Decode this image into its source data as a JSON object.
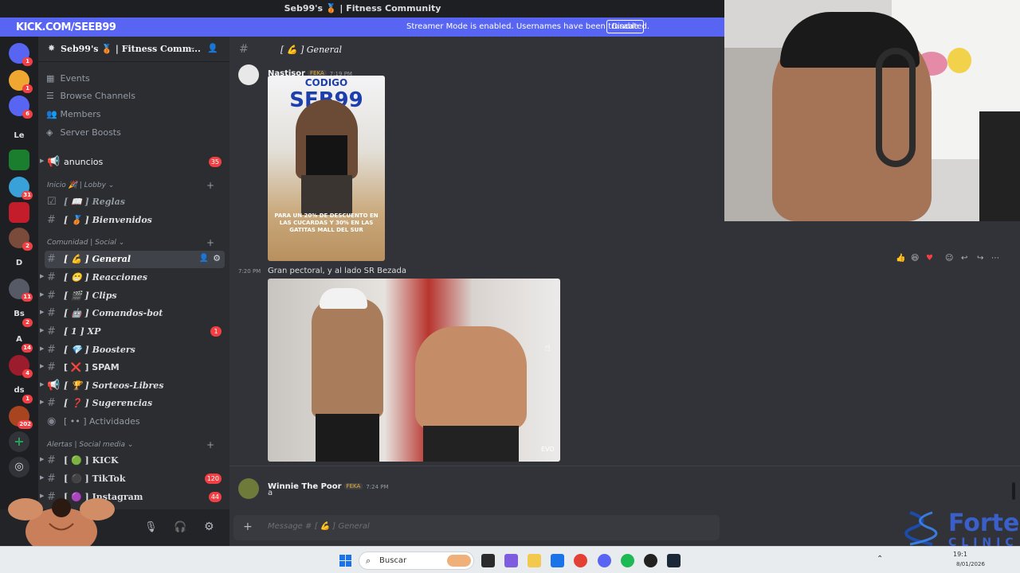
{
  "window": {
    "title": "Seb99's 🥉 | Fitness Community"
  },
  "streamer_banner": {
    "message": "Streamer Mode is enabled. Usernames have been truncated.",
    "disable_label": "Disable"
  },
  "overlay": {
    "kick_url": "KICK.COM/SEEB99"
  },
  "server_rail": {
    "items": [
      {
        "label": "",
        "badge": "12"
      },
      {
        "label": "",
        "badge": "1"
      },
      {
        "label": "",
        "badge": "1"
      },
      {
        "label": "",
        "badge": "6"
      },
      {
        "label": "Le",
        "badge": ""
      },
      {
        "label": "",
        "badge": ""
      },
      {
        "label": "",
        "badge": "31"
      },
      {
        "label": "",
        "badge": ""
      },
      {
        "label": "",
        "badge": "2"
      },
      {
        "label": "D",
        "badge": ""
      },
      {
        "label": "",
        "badge": "11"
      },
      {
        "label": "Bs",
        "badge": "2"
      },
      {
        "label": "A",
        "badge": "14"
      },
      {
        "label": "",
        "badge": "4"
      },
      {
        "label": "ds",
        "badge": "1"
      },
      {
        "label": "",
        "badge": "202"
      }
    ]
  },
  "sidebar": {
    "server_name": "Seb99's 🥉 | Fitness Comm...",
    "nav": [
      "Events",
      "Browse Channels",
      "Members",
      "Server Boosts"
    ],
    "announcements": {
      "label": "anuncios",
      "count": "35"
    },
    "categories": [
      {
        "label": "Inicio 🎉 | Lobby ⌄"
      },
      {
        "label": "Comunidad | Social ⌄"
      },
      {
        "label": "Alertas | Social media ⌄"
      }
    ],
    "lobby_channels": [
      {
        "label": "[ 📖 ] Reglas"
      },
      {
        "label": "[ 🥉 ] Bienvenidos"
      }
    ],
    "social_channels": [
      {
        "label": "[ 💪 ] General",
        "count": ""
      },
      {
        "label": "[ 😁 ] Reacciones",
        "count": ""
      },
      {
        "label": "[ 🎬 ] Clips",
        "count": ""
      },
      {
        "label": "[ 🤖 ] Comandos-bot",
        "count": ""
      },
      {
        "label": "[ 1 ] XP",
        "count": "1"
      },
      {
        "label": "[ 💎 ] Boosters",
        "count": ""
      },
      {
        "label": "[ ❌ ] SPAM",
        "count": ""
      },
      {
        "label": "[ 🏆 ] Sorteos-Libres",
        "count": ""
      },
      {
        "label": "[ ❓ ] Sugerencias",
        "count": ""
      },
      {
        "label": "[ •• ] Actividades",
        "count": ""
      }
    ],
    "media_channels": [
      {
        "label": "[ 🟢 ] KICK",
        "count": ""
      },
      {
        "label": "[ ⚫ ] TikTok",
        "count": "120"
      },
      {
        "label": "[ 🟣 ] Instagram",
        "count": "44"
      }
    ]
  },
  "chat": {
    "channel_title": "[ 💪 ] General",
    "messages": [
      {
        "author": "Nastisor",
        "tag": "FEKA",
        "time": "7:19 PM",
        "image_text": {
          "top": "CODIGO",
          "big": "SEB99",
          "promo": "PARA UN 20% DE DESCUENTO EN LAS CUCARDAS Y 30% EN LAS GATITAS MALL DEL SUR"
        }
      },
      {
        "author": "",
        "time": "7:20 PM",
        "text": "Gran pectoral, y al lado SR Bezada",
        "watermark": "EVO"
      },
      {
        "author": "Winnie The Poor",
        "tag": "FEKA",
        "time": "7:24 PM",
        "text": "a"
      }
    ],
    "input_placeholder": "Message # [ 💪 ] General"
  },
  "taskbar": {
    "search_placeholder": "Buscar",
    "date": "8/01/2026",
    "time": "19:1"
  },
  "brand_overlay": {
    "line1": "Fortex",
    "line2": "CLINIC"
  },
  "colors": {
    "accent": "#5865f2",
    "kick": "#53fc18",
    "badge": "#f23f43",
    "sidebar": "#2b2d31",
    "chat": "#313338"
  }
}
